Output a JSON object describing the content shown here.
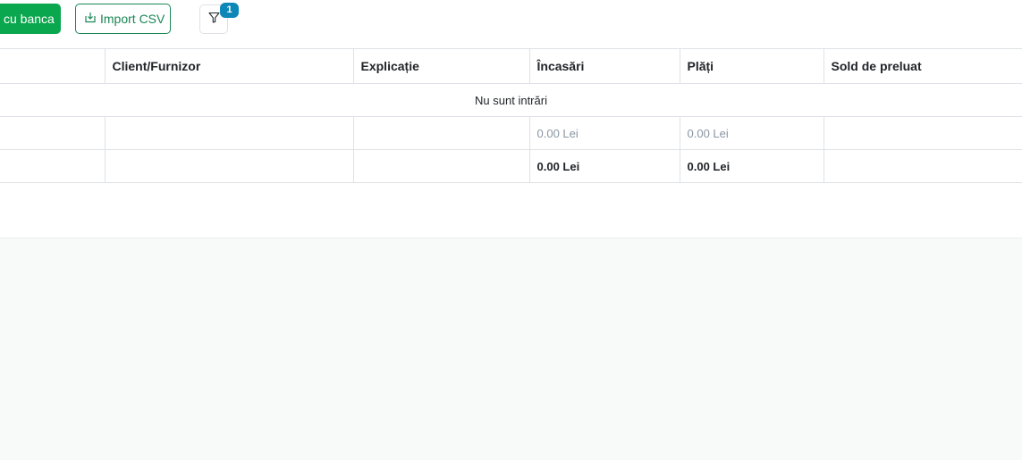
{
  "toolbar": {
    "bank_button_label": "cu banca",
    "import_button_label": "Import CSV",
    "filter_badge_count": "1",
    "colors": {
      "green": "#0ba74e",
      "badge": "#0d86b8"
    }
  },
  "table": {
    "columns": [
      "",
      "Client/Furnizor",
      "Explicație",
      "Încasări",
      "Plăți",
      "Sold de preluat"
    ],
    "empty_message": "Nu sunt intrări",
    "subtotal_row": {
      "incasari": "0.00 Lei",
      "plati": "0.00 Lei"
    },
    "total_row": {
      "incasari": "0.00 Lei",
      "plati": "0.00 Lei"
    }
  }
}
